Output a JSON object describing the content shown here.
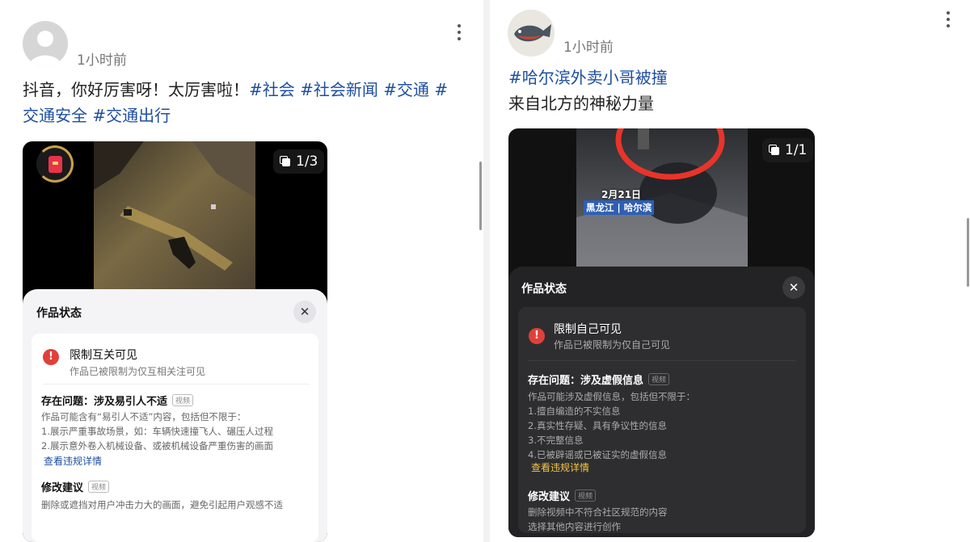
{
  "left_post": {
    "timestamp": "1小时前",
    "text_prefix": "抖音，你好厉害呀！太厉害啦！",
    "hashtags": [
      "#社会",
      "#社会新闻",
      "#交通",
      "#交通安全",
      "#交通出行"
    ],
    "media_counter": "1/3",
    "sheet": {
      "title": "作品状态",
      "close_icon": "✕",
      "status_title": "限制互关可见",
      "status_sub": "作品已被限制为仅互相关注可见",
      "issue_title": "存在问题：涉及易引人不适",
      "issue_tag": "视频",
      "issue_lines": [
        "作品可能含有“易引人不适”内容，包括但不限于：",
        "1.展示严重事故场景，如：车辆快速撞飞人、碾压人过程",
        "2.展示意外卷入机械设备、或被机械设备严重伤害的画面"
      ],
      "detail_link": "查看违规详情",
      "suggest_title": "修改建议",
      "suggest_tag": "视频",
      "suggest_lines": [
        "删除或遮挡对用户冲击力大的画面，避免引起用户观感不适"
      ]
    }
  },
  "right_post": {
    "timestamp": "1小时前",
    "hashtag_line": "#哈尔滨外卖小哥被撞",
    "text_line": "来自北方的神秘力量",
    "media_counter": "1/1",
    "video_date": "2月21日",
    "video_location": "黑龙江 | 哈尔滨",
    "sheet": {
      "title": "作品状态",
      "close_icon": "✕",
      "status_title": "限制自己可见",
      "status_sub": "作品已被限制为仅自己可见",
      "issue_title": "存在问题：涉及虚假信息",
      "issue_tag": "视频",
      "issue_lines": [
        "作品可能涉及虚假信息，包括但不限于：",
        "1.擅自编造的不实信息",
        "2.真实性存疑、具有争议性的信息",
        "3.不完整信息",
        "4.已被辟谣或已被证实的虚假信息"
      ],
      "detail_link": "查看违规详情",
      "suggest_title": "修改建议",
      "suggest_tag": "视频",
      "suggest_lines": [
        "删除视频中不符合社区规范的内容",
        "选择其他内容进行创作"
      ]
    }
  },
  "colors": {
    "hashtag": "#1e4ea0",
    "warning": "#e0403a",
    "link_dark": "#f5c542",
    "annotation_circle": "#e8342a"
  }
}
